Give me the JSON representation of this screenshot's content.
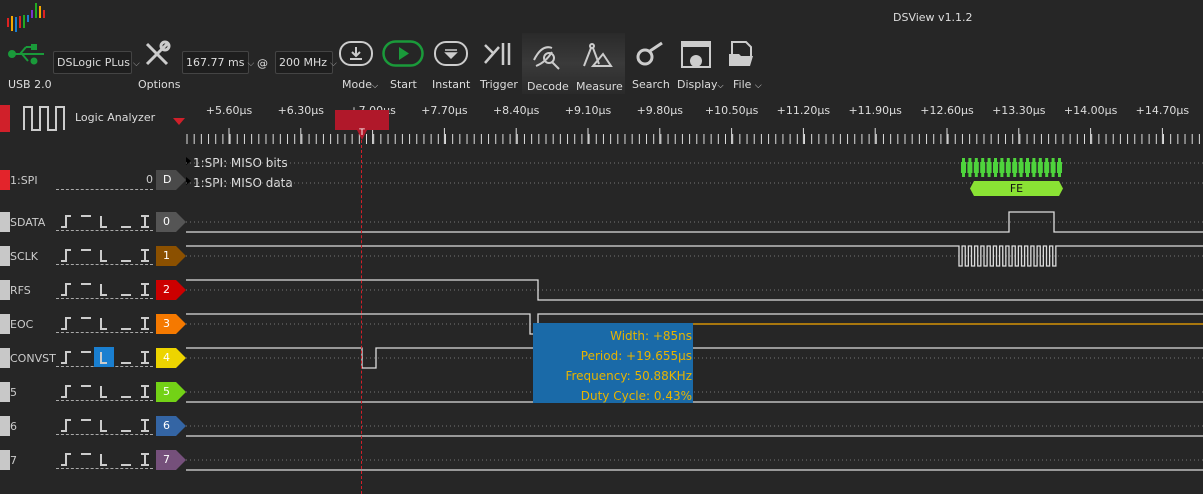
{
  "app": {
    "title": "DSView v1.1.2"
  },
  "toolbar": {
    "usb_label": "USB 2.0",
    "device": "DSLogic PLus",
    "options": "Options",
    "duration": "167.77 ms",
    "at": "@",
    "rate": "200 MHz",
    "mode": "Mode",
    "start": "Start",
    "instant": "Instant",
    "trigger": "Trigger",
    "decode": "Decode",
    "measure": "Measure",
    "search": "Search",
    "display": "Display",
    "file": "File"
  },
  "header": {
    "mode_name": "Logic Analyzer"
  },
  "ruler": [
    "+5.60µs",
    "+6.30µs",
    "+7.00µs",
    "+7.70µs",
    "+8.40µs",
    "+9.10µs",
    "+9.80µs",
    "+10.50µs",
    "+11.20µs",
    "+11.90µs",
    "+12.60µs",
    "+13.30µs",
    "+14.00µs",
    "+14.70µs"
  ],
  "trigger_marker": "T",
  "decoder": {
    "name": "1:SPI",
    "value": "0",
    "tag": "D",
    "rows": [
      "1:SPI: MISO bits",
      "1:SPI: MISO data"
    ],
    "data_value": "FE"
  },
  "channels": [
    {
      "name": "SDATA",
      "index": "0",
      "color": "#555555"
    },
    {
      "name": "SCLK",
      "index": "1",
      "color": "#8b5000"
    },
    {
      "name": "RFS",
      "index": "2",
      "color": "#cc0000"
    },
    {
      "name": "EOC",
      "index": "3",
      "color": "#f57900"
    },
    {
      "name": "CONVST",
      "index": "4",
      "color": "#edd400"
    },
    {
      "name": "5",
      "index": "5",
      "color": "#73d216"
    },
    {
      "name": "6",
      "index": "6",
      "color": "#3465a4"
    },
    {
      "name": "7",
      "index": "7",
      "color": "#75507b"
    }
  ],
  "measurement": {
    "width": "Width: +85ns",
    "period": "Period: +19.655µs",
    "frequency": "Frequency: 50.88KHz",
    "duty": "Duty Cycle: 0.43%"
  }
}
